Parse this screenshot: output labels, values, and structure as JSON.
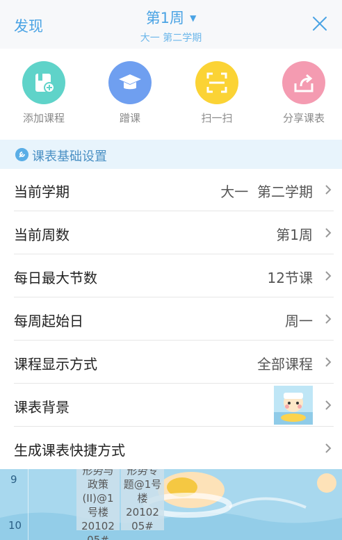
{
  "header": {
    "discover_label": "发现",
    "week_label": "第1周",
    "term_label": "大一 第二学期"
  },
  "actions": [
    {
      "label": "添加课程",
      "color": "#5fd3c9",
      "icon": "add-course-icon"
    },
    {
      "label": "蹭课",
      "color": "#6f9ff0",
      "icon": "graduation-cap-icon"
    },
    {
      "label": "扫一扫",
      "color": "#fbd335",
      "icon": "scan-icon"
    },
    {
      "label": "分享课表",
      "color": "#f49bb1",
      "icon": "share-icon"
    }
  ],
  "section": {
    "title": "课表基础设置"
  },
  "settings": [
    {
      "label": "当前学期",
      "value": "大一  第二学期"
    },
    {
      "label": "当前周数",
      "value": "第1周"
    },
    {
      "label": "每日最大节数",
      "value": "12节课"
    },
    {
      "label": "每周起始日",
      "value": "周一"
    },
    {
      "label": "课程显示方式",
      "value": "全部课程"
    },
    {
      "label": "课表背景",
      "value": ""
    },
    {
      "label": "生成课表快捷方式",
      "value": ""
    }
  ],
  "timetable_bg": {
    "periods": [
      "9",
      "10"
    ],
    "card1": "形势与\n政策\n(II)@1\n号楼\n20102\n05#",
    "card2": "形势专\n题@1号\n楼\n20102\n05#"
  }
}
